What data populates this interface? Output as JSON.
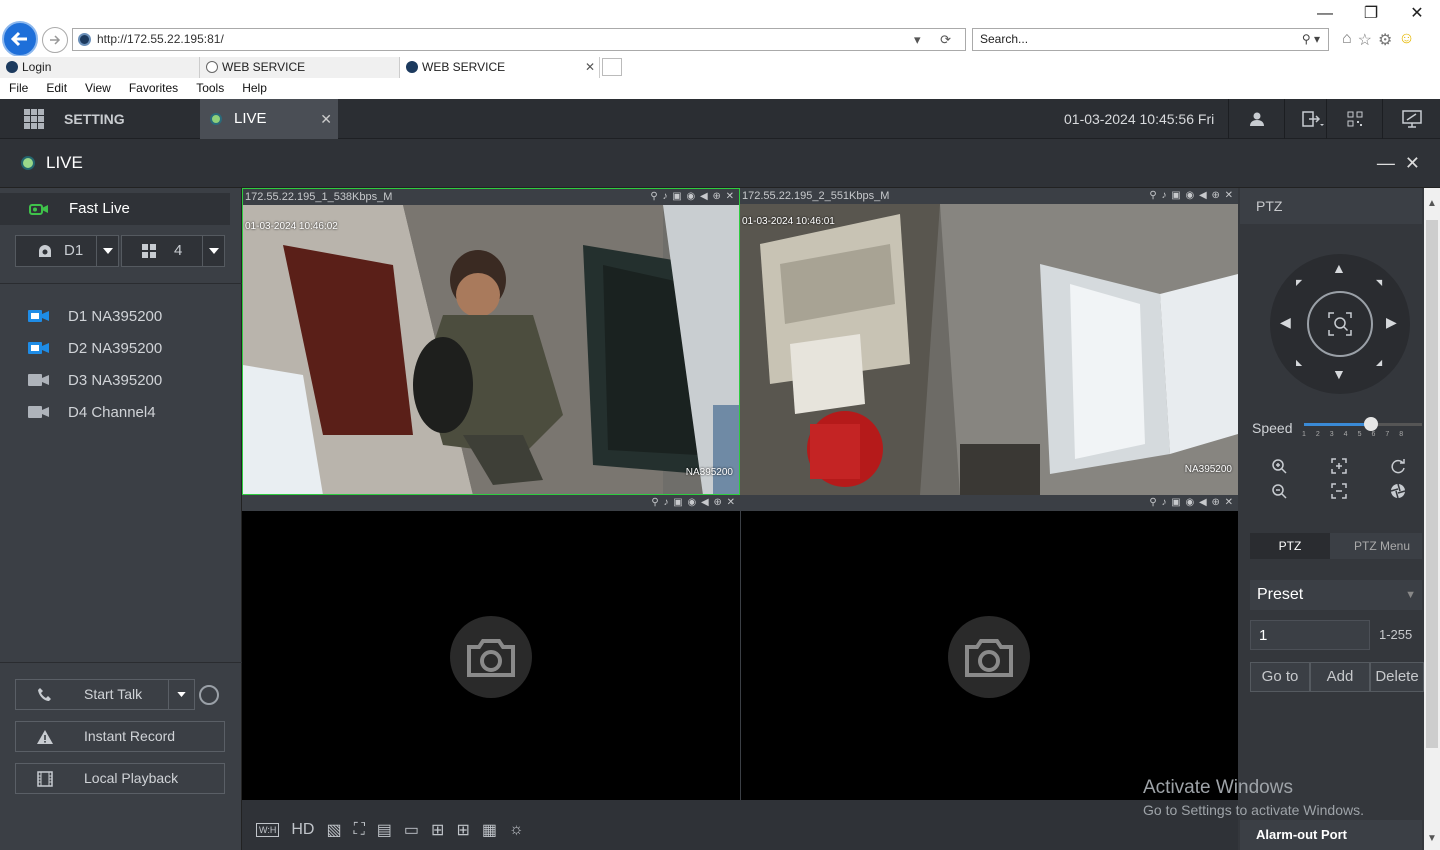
{
  "browser": {
    "url": "http://172.55.22.195:81/",
    "search_placeholder": "Search...",
    "tabs": [
      {
        "label": "Login"
      },
      {
        "label": "WEB SERVICE"
      },
      {
        "label": "WEB SERVICE"
      }
    ],
    "menu": [
      "File",
      "Edit",
      "View",
      "Favorites",
      "Tools",
      "Help"
    ]
  },
  "app": {
    "setting_label": "SETTING",
    "live_tab_label": "LIVE",
    "datetime": "01-03-2024 10:45:56 Fri",
    "page_title": "LIVE"
  },
  "left": {
    "fast_live": "Fast Live",
    "stream_select": "D1",
    "split_select": "4",
    "devices": [
      {
        "label": "D1 NA395200",
        "active": true
      },
      {
        "label": "D2 NA395200",
        "active": true
      },
      {
        "label": "D3 NA395200",
        "active": false
      },
      {
        "label": "D4 Channel4",
        "active": false
      }
    ],
    "start_talk": "Start Talk",
    "instant_record": "Instant Record",
    "local_playback": "Local Playback"
  },
  "video": {
    "panes": [
      {
        "title": "172.55.22.195_1_538Kbps_M",
        "timestamp": "01-03-2024 10:46:02",
        "device": "NA395200"
      },
      {
        "title": "172.55.22.195_2_551Kbps_M",
        "timestamp": "01-03-2024 10:46:01",
        "device": "NA395200"
      },
      {
        "title": "",
        "timestamp": "",
        "device": ""
      },
      {
        "title": "",
        "timestamp": "",
        "device": ""
      }
    ],
    "toolbar_hd": "HD",
    "toolbar_wh": "W:H"
  },
  "ptz": {
    "header": "PTZ",
    "speed_label": "Speed",
    "speed_ticks": "12345678",
    "speed_value": 5,
    "tab_ptz": "PTZ",
    "tab_menu": "PTZ Menu",
    "preset_label": "Preset",
    "preset_value": "1",
    "preset_range": "1-255",
    "goto": "Go to",
    "add": "Add",
    "delete": "Delete",
    "alarm_out": "Alarm-out Port"
  },
  "watermark": {
    "line1": "Activate Windows",
    "line2": "Go to Settings to activate Windows."
  },
  "colors": {
    "selected_pane_border": "#2ecc40",
    "accent_blue": "#1e8ce6",
    "live_dot": "#8fd17a"
  }
}
